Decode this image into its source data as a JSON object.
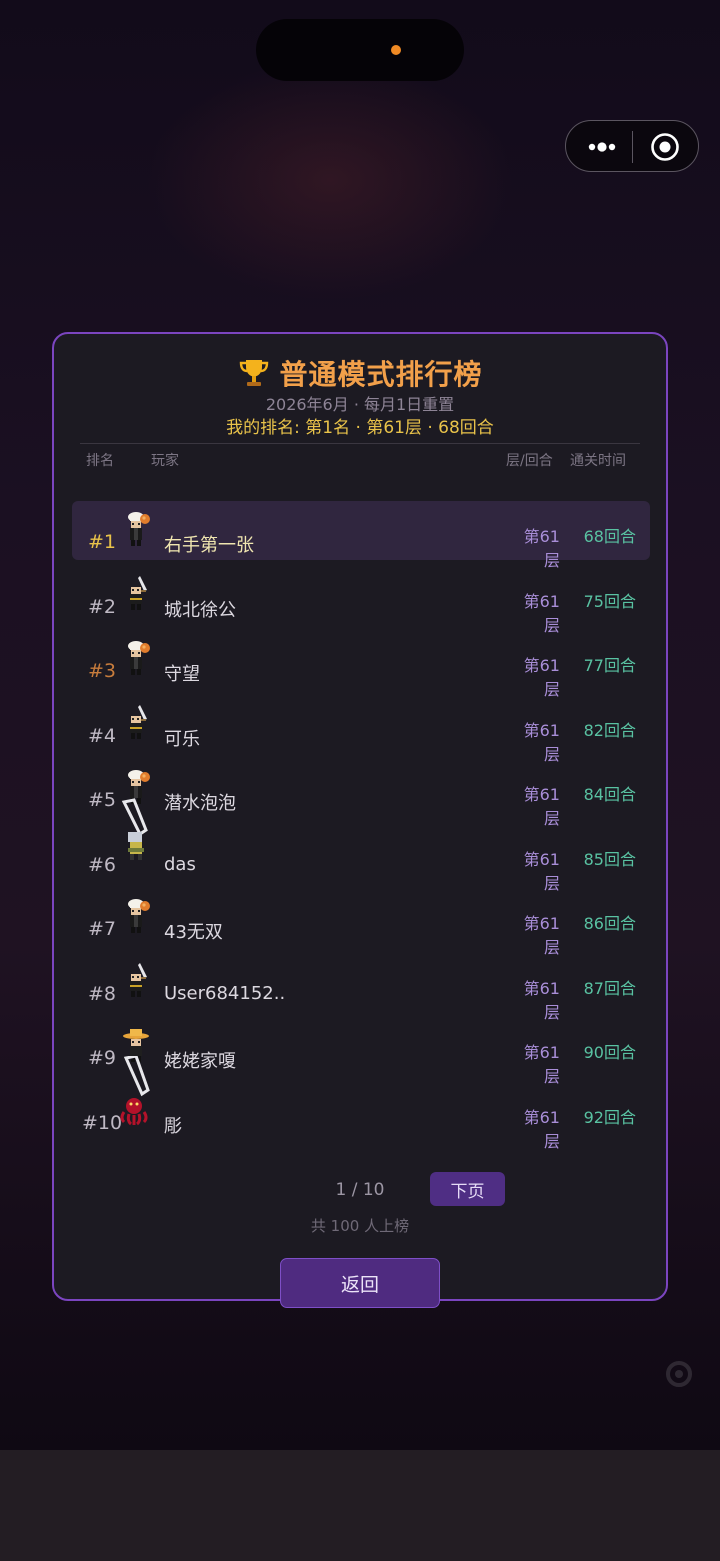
{
  "leaderboard": {
    "title": "普通模式排行榜",
    "subtitle": "2026年6月 · 每月1日重置",
    "my_rank": "我的排名: 第1名 · 第61层 · 68回合",
    "headers": {
      "rank": "排名",
      "player": "玩家",
      "floor_turns": "层/回合",
      "clear_time": "通关时间"
    },
    "rows": [
      {
        "rank": "#1",
        "name": "右手第一张",
        "floor": "第61层",
        "turns": "68回合",
        "avatar": "chef-avatar"
      },
      {
        "rank": "#2",
        "name": "城北徐公",
        "floor": "第61层",
        "turns": "75回合",
        "avatar": "swordsman-avatar"
      },
      {
        "rank": "#3",
        "name": "守望",
        "floor": "第61层",
        "turns": "77回合",
        "avatar": "chef-avatar"
      },
      {
        "rank": "#4",
        "name": "可乐",
        "floor": "第61层",
        "turns": "82回合",
        "avatar": "swordsman-avatar"
      },
      {
        "rank": "#5",
        "name": "潜水泡泡",
        "floor": "第61层",
        "turns": "84回合",
        "avatar": "chef-avatar"
      },
      {
        "rank": "#6",
        "name": "das",
        "floor": "第61层",
        "turns": "85回合",
        "avatar": "knight-greatsword-avatar"
      },
      {
        "rank": "#7",
        "name": "43无双",
        "floor": "第61层",
        "turns": "86回合",
        "avatar": "chef-avatar"
      },
      {
        "rank": "#8",
        "name": "User684152..",
        "floor": "第61层",
        "turns": "87回合",
        "avatar": "swordsman-avatar"
      },
      {
        "rank": "#9",
        "name": "姥姥家嗄",
        "floor": "第61层",
        "turns": "90回合",
        "avatar": "straw-hat-avatar"
      },
      {
        "rank": "#10",
        "name": "彫",
        "floor": "第61层",
        "turns": "92回合",
        "avatar": "octopus-greatsword-avatar"
      }
    ],
    "page_info": "1 / 10",
    "next_label": "下页",
    "total": "共 100 人上榜",
    "back_label": "返回"
  },
  "colors": {
    "accent": "#7b45c0",
    "title": "#f2a04a",
    "gold": "#e9c34a",
    "bronze": "#c77c3c",
    "floor": "#a98ed8",
    "turns": "#59c2a2"
  }
}
